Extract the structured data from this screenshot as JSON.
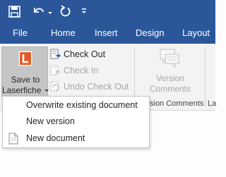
{
  "qat": {
    "save_icon": "save-icon",
    "undo_icon": "undo-icon",
    "undo_dropdown_icon": "chevron-down-icon",
    "redo_icon": "redo-icon",
    "customize_icon": "customize-qat-icon"
  },
  "tabs": [
    "File",
    "Home",
    "Insert",
    "Design",
    "Layout"
  ],
  "ribbon": {
    "save_button": {
      "line1": "Save to",
      "line2": "Laserfiche",
      "icon": "laserfiche-icon"
    },
    "check_out": "Check Out",
    "check_in": "Check In",
    "undo_check_out": "Undo Check Out",
    "version_comments": {
      "line1": "Version",
      "line2": "Comments",
      "icon": "comments-icon"
    },
    "group_labels": {
      "version_comments": "sion Comments",
      "next": "La"
    }
  },
  "dropdown": {
    "items": [
      "Overwrite existing document",
      "New version",
      "New document"
    ]
  },
  "colors": {
    "title_bar": "#2b579a",
    "accent_logo": "#e05a28"
  }
}
